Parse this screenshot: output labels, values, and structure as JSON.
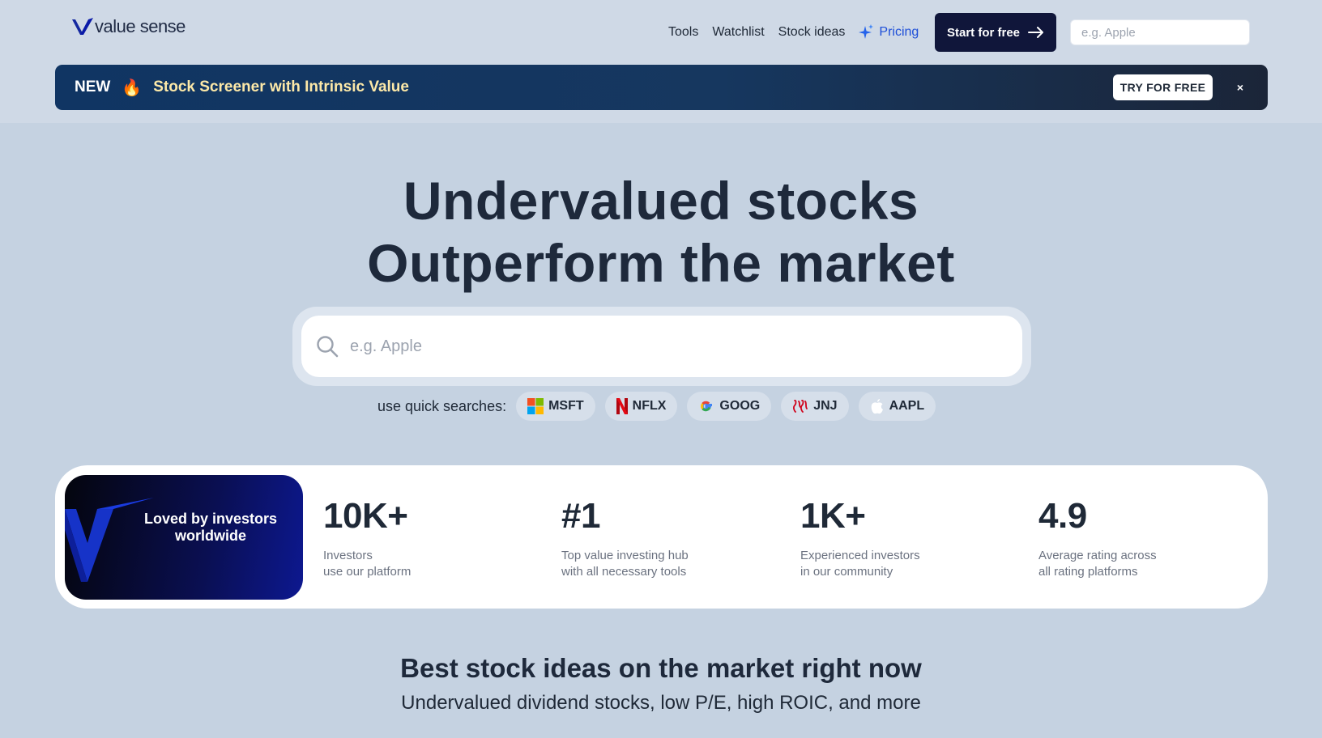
{
  "header": {
    "logo_text": "value sense",
    "nav": [
      {
        "label": "Tools"
      },
      {
        "label": "Watchlist"
      },
      {
        "label": "Stock ideas"
      },
      {
        "label": "Pricing"
      }
    ],
    "start_button": "Start for free",
    "search_placeholder": "e.g. Apple"
  },
  "banner": {
    "new_label": "NEW",
    "fire_emoji": "🔥",
    "text": "Stock Screener with Intrinsic Value",
    "try_button": "TRY FOR FREE",
    "close": "×"
  },
  "hero": {
    "title_line1": "Undervalued stocks",
    "title_line2": "Outperform the market",
    "search_placeholder": "e.g. Apple",
    "quick_label": "use quick searches:",
    "quick_searches": [
      {
        "ticker": "MSFT",
        "icon": "microsoft-icon"
      },
      {
        "ticker": "NFLX",
        "icon": "netflix-icon"
      },
      {
        "ticker": "GOOG",
        "icon": "google-icon"
      },
      {
        "ticker": "JNJ",
        "icon": "jnj-icon"
      },
      {
        "ticker": "AAPL",
        "icon": "apple-icon"
      }
    ]
  },
  "stats": {
    "card_text": "Loved by investors worldwide",
    "items": [
      {
        "value": "10K+",
        "line1": "Investors",
        "line2": "use our platform"
      },
      {
        "value": "#1",
        "line1": "Top value investing hub",
        "line2": "with all necessary tools"
      },
      {
        "value": "1K+",
        "line1": "Experienced investors",
        "line2": "in our community"
      },
      {
        "value": "4.9",
        "line1": "Average rating across",
        "line2": "all rating platforms"
      }
    ]
  },
  "section": {
    "title": "Best stock ideas on the market right now",
    "subtitle": "Undervalued dividend stocks, low P/E, high ROIC, and more"
  },
  "colors": {
    "brand_dark": "#10163a",
    "pricing_blue": "#1d4ed8",
    "banner_highlight": "#fde9a8",
    "page_bg": "#c5d2e1"
  }
}
